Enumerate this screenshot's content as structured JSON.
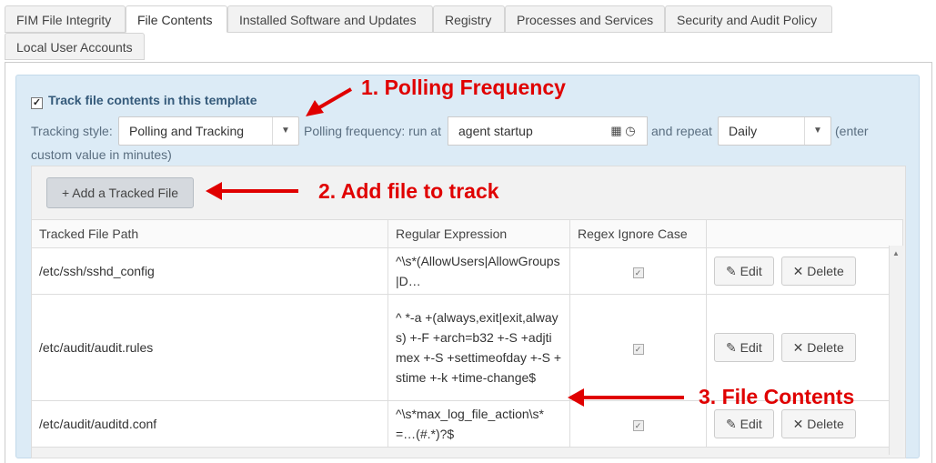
{
  "tabs": [
    {
      "label": "FIM File Integrity"
    },
    {
      "label": "File Contents"
    },
    {
      "label": "Installed Software and Updates"
    },
    {
      "label": "Registry"
    },
    {
      "label": "Processes and Services"
    },
    {
      "label": "Security and Audit Policy"
    },
    {
      "label": "Local User Accounts"
    }
  ],
  "active_tab": "File Contents",
  "settings": {
    "track_label": "Track file contents in this template",
    "track_checked": true,
    "tracking_style_label": "Tracking style:",
    "tracking_style_value": "Polling and Tracking",
    "polling_label": "Polling frequency: run at",
    "run_at_value": "agent startup",
    "repeat_label": "and repeat",
    "repeat_value": "Daily",
    "enter_label": "(enter",
    "custom_note": "custom value in minutes)"
  },
  "add_button_label": "+ Add a Tracked File",
  "table": {
    "headers": [
      "Tracked File Path",
      "Regular Expression",
      "Regex Ignore Case",
      ""
    ],
    "rows": [
      {
        "path": "/etc/ssh/sshd_config",
        "regex": "^\\s*(AllowUsers|AllowGroups|D…",
        "ignore_case": true
      },
      {
        "path": "/etc/audit/audit.rules",
        "regex": "^ *-a +(always,exit|exit,always) +-F +arch=b32 +-S +adjtimex +-S +settimeofday +-S +stime +-k +time-change$",
        "ignore_case": true
      },
      {
        "path": "/etc/audit/auditd.conf",
        "regex": "^\\s*max_log_file_action\\s*=…(#.*)?$",
        "ignore_case": true
      }
    ],
    "edit_label": "Edit",
    "delete_label": "Delete"
  },
  "annotations": {
    "a1": "1. Polling Frequency",
    "a2": "2. Add file to track",
    "a3": "3. File Contents"
  },
  "colors": {
    "annotation": "#e00000",
    "panel_blue": "#dcebf6"
  }
}
